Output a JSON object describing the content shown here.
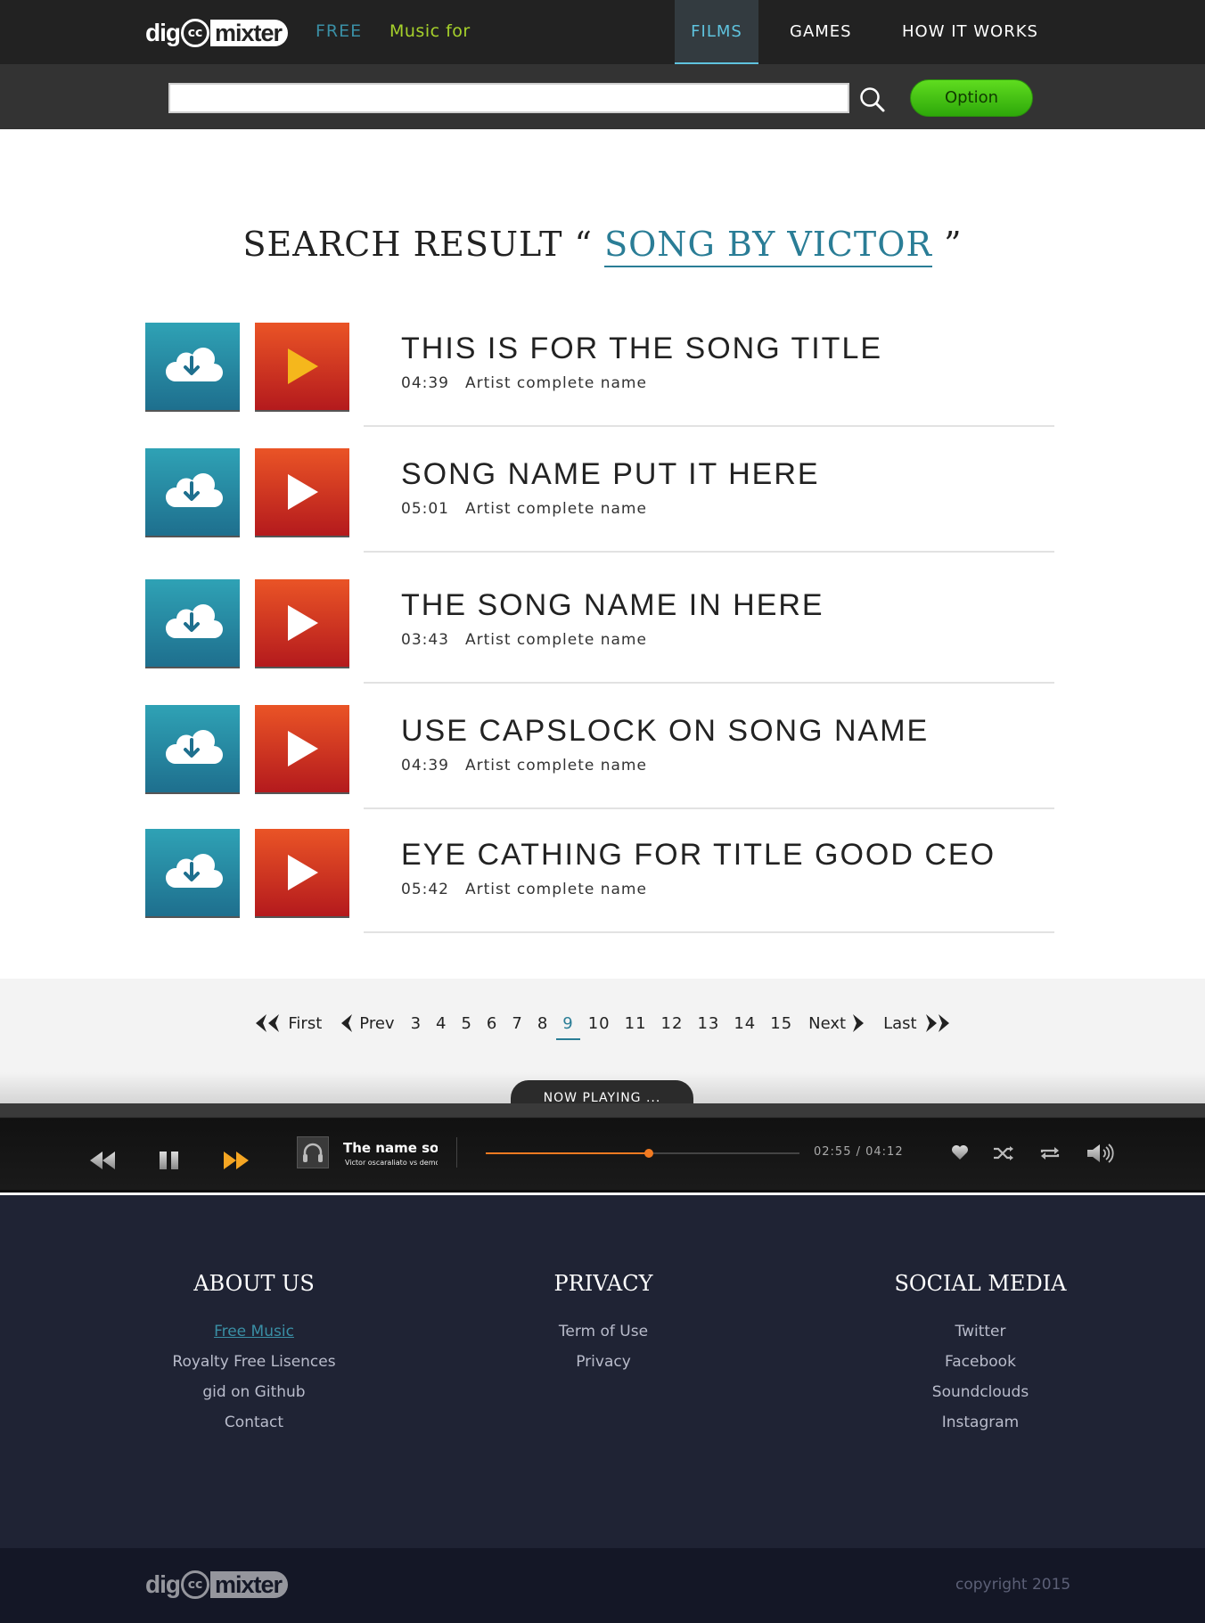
{
  "header": {
    "logo": {
      "part1": "dig",
      "cc": "cc",
      "part2": "mixter"
    },
    "tagline_free": "FREE",
    "tagline_music": "Music for",
    "nav": [
      {
        "label": "FILMS",
        "active": true
      },
      {
        "label": "GAMES",
        "active": false
      },
      {
        "label": "HOW IT WORKS",
        "active": false
      }
    ]
  },
  "search": {
    "value": "",
    "placeholder": "",
    "option_label": "Option"
  },
  "results": {
    "prefix": "SEARCH RESULT “",
    "query": "SONG BY VICTOR",
    "suffix": "”"
  },
  "songs": [
    {
      "title": "THIS IS FOR THE SONG TITLE",
      "duration": "04:39",
      "artist": "Artist complete name",
      "play_color": "#f5b71c"
    },
    {
      "title": "SONG NAME PUT IT HERE",
      "duration": "05:01",
      "artist": "Artist complete name",
      "play_color": "#ffffff"
    },
    {
      "title": "THE SONG NAME IN HERE",
      "duration": "03:43",
      "artist": "Artist complete name",
      "play_color": "#ffffff"
    },
    {
      "title": "USE CAPSLOCK ON SONG NAME",
      "duration": "04:39",
      "artist": "Artist complete name",
      "play_color": "#ffffff"
    },
    {
      "title": "EYE CATHING FOR TITLE GOOD CEO",
      "duration": "05:42",
      "artist": "Artist complete name",
      "play_color": "#ffffff"
    }
  ],
  "pagination": {
    "first": "First",
    "prev": "Prev",
    "pages": [
      "3",
      "4",
      "5",
      "6",
      "7",
      "8",
      "9",
      "10",
      "11",
      "12",
      "13",
      "14",
      "15"
    ],
    "active": "9",
    "next": "Next",
    "last": "Last"
  },
  "player": {
    "tab_label": "NOW PLAYING ...",
    "song": "The name song",
    "artist": "Victor oscaraliato vs demo",
    "elapsed": "02:55",
    "total": "04:12",
    "progress": 0.52,
    "accent": "#f27a21"
  },
  "footer": {
    "about": {
      "title": "ABOUT US",
      "links": [
        "Free Music",
        "Royalty Free Lisences",
        "gid on Github",
        "Contact"
      ]
    },
    "privacy": {
      "title": "PRIVACY",
      "links": [
        "Term of Use",
        "Privacy"
      ]
    },
    "social": {
      "title": "SOCIAL MEDIA",
      "links": [
        "Twitter",
        "Facebook",
        "Soundclouds",
        "Instagram"
      ]
    },
    "copyright": "copyright 2015"
  }
}
